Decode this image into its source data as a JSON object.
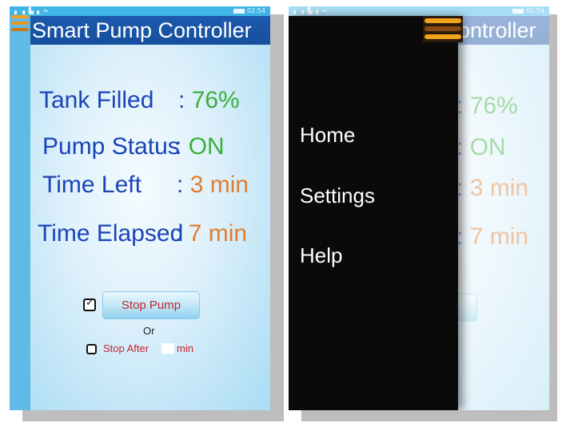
{
  "status_bar": {
    "signal": "▖▗ ▙▗ ≈",
    "time": "02:54"
  },
  "app": {
    "title": "Smart Pump Controller",
    "title_partial": "ontroller"
  },
  "stats": [
    {
      "label": "Tank Filled",
      "value": "76%",
      "color": "#3bb03b"
    },
    {
      "label": "Pump Status",
      "value": "ON",
      "color": "#3bb03b"
    },
    {
      "label": "Time Left",
      "value": "3 min",
      "color": "#e07d2e"
    },
    {
      "label": "Time Elapsed",
      "value": "7 min",
      "color": "#e07d2e"
    }
  ],
  "separator": ":",
  "controls": {
    "stop_pump_checked": true,
    "stop_pump_label": "Stop Pump",
    "or_label": "Or",
    "stop_after_checked": false,
    "stop_after_label": "Stop After",
    "stop_after_value": "",
    "min_label": "min"
  },
  "drawer": {
    "items": [
      "Home",
      "Settings",
      "Help"
    ]
  },
  "colors": {
    "title_bar": "#1d59ad",
    "menu_icon": "#f3a21c",
    "label": "#1b44b8",
    "stop_text": "#c1272d"
  }
}
